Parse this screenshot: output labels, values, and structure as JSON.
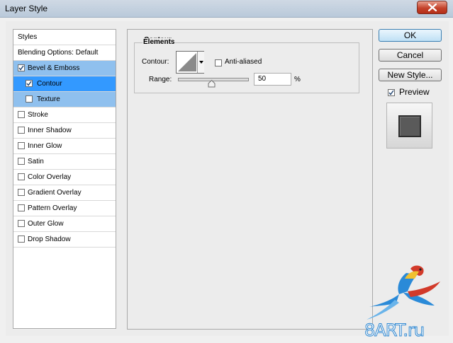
{
  "window": {
    "title": "Layer Style"
  },
  "styles_list": {
    "header": "Styles",
    "blending_options": "Blending Options: Default",
    "items": [
      {
        "label": "Bevel & Emboss",
        "checked": true,
        "selected": "parent"
      },
      {
        "label": "Contour",
        "checked": true,
        "selected": "active"
      },
      {
        "label": "Texture",
        "checked": false,
        "selected": "parent"
      },
      {
        "label": "Stroke",
        "checked": false
      },
      {
        "label": "Inner Shadow",
        "checked": false
      },
      {
        "label": "Inner Glow",
        "checked": false
      },
      {
        "label": "Satin",
        "checked": false
      },
      {
        "label": "Color Overlay",
        "checked": false
      },
      {
        "label": "Gradient Overlay",
        "checked": false
      },
      {
        "label": "Pattern Overlay",
        "checked": false
      },
      {
        "label": "Outer Glow",
        "checked": false
      },
      {
        "label": "Drop Shadow",
        "checked": false
      }
    ]
  },
  "contour_panel": {
    "title": "Contour",
    "elements_title": "Elements",
    "contour_label": "Contour:",
    "anti_aliased_label": "Anti-aliased",
    "anti_aliased": false,
    "range_label": "Range:",
    "range_value": "50",
    "range_unit": "%",
    "range_slider_level": 0.5
  },
  "buttons": {
    "ok": "OK",
    "cancel": "Cancel",
    "new_style": "New Style...",
    "preview_label": "Preview",
    "preview_checked": true
  },
  "watermark": {
    "text": "8ART.ru"
  },
  "colors": {
    "selection_active": "#3399ff",
    "selection_parent": "#8fc0ee",
    "close_button": "#c4432c",
    "logo_blue": "#2d86d0"
  }
}
